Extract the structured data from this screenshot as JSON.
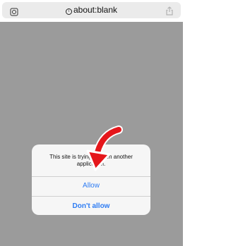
{
  "browser": {
    "url": "about:blank"
  },
  "dialog": {
    "message": "This site is trying to open another application.",
    "allow_label": "Allow",
    "deny_label": "Don't allow"
  },
  "colors": {
    "page_background": "#9b9b9b",
    "dialog_background": "#f6f6f6",
    "accent_blue": "#2d7cf3",
    "arrow_red": "#e5161b"
  },
  "icons": {
    "left": "page-settings-icon",
    "info": "info-icon",
    "right": "share-icon",
    "overlay": "red-arrow-icon"
  }
}
